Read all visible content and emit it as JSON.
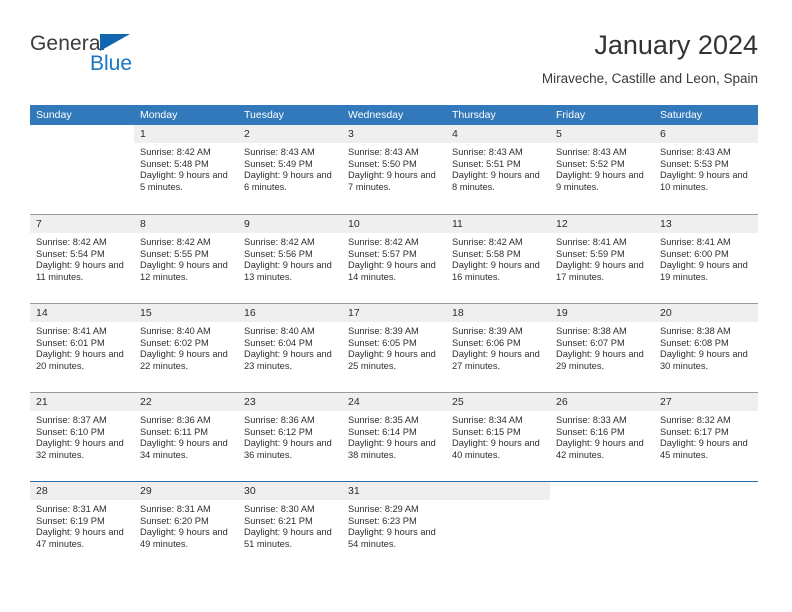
{
  "brand": {
    "name_top": "General",
    "name_bottom": "Blue",
    "triangle_color": "#1266b0",
    "blue_color": "#1a76c4"
  },
  "header": {
    "title": "January 2024",
    "subtitle": "Miraveche, Castille and Leon, Spain"
  },
  "theme": {
    "header_row_bg": "#3279bb",
    "header_row_text": "#ffffff",
    "day_number_bg": "#efefef",
    "row_border": "#9a9a9a",
    "last_row_border": "#2a6ca8"
  },
  "weekdays": [
    "Sunday",
    "Monday",
    "Tuesday",
    "Wednesday",
    "Thursday",
    "Friday",
    "Saturday"
  ],
  "weeks": [
    [
      {
        "day": "",
        "sunrise": "",
        "sunset": "",
        "daylight": "",
        "empty": true,
        "shaded": false
      },
      {
        "day": "1",
        "sunrise": "Sunrise: 8:42 AM",
        "sunset": "Sunset: 5:48 PM",
        "daylight": "Daylight: 9 hours and 5 minutes.",
        "empty": false,
        "shaded": true
      },
      {
        "day": "2",
        "sunrise": "Sunrise: 8:43 AM",
        "sunset": "Sunset: 5:49 PM",
        "daylight": "Daylight: 9 hours and 6 minutes.",
        "empty": false,
        "shaded": true
      },
      {
        "day": "3",
        "sunrise": "Sunrise: 8:43 AM",
        "sunset": "Sunset: 5:50 PM",
        "daylight": "Daylight: 9 hours and 7 minutes.",
        "empty": false,
        "shaded": true
      },
      {
        "day": "4",
        "sunrise": "Sunrise: 8:43 AM",
        "sunset": "Sunset: 5:51 PM",
        "daylight": "Daylight: 9 hours and 8 minutes.",
        "empty": false,
        "shaded": true
      },
      {
        "day": "5",
        "sunrise": "Sunrise: 8:43 AM",
        "sunset": "Sunset: 5:52 PM",
        "daylight": "Daylight: 9 hours and 9 minutes.",
        "empty": false,
        "shaded": true
      },
      {
        "day": "6",
        "sunrise": "Sunrise: 8:43 AM",
        "sunset": "Sunset: 5:53 PM",
        "daylight": "Daylight: 9 hours and 10 minutes.",
        "empty": false,
        "shaded": true
      }
    ],
    [
      {
        "day": "7",
        "sunrise": "Sunrise: 8:42 AM",
        "sunset": "Sunset: 5:54 PM",
        "daylight": "Daylight: 9 hours and 11 minutes.",
        "empty": false,
        "shaded": true
      },
      {
        "day": "8",
        "sunrise": "Sunrise: 8:42 AM",
        "sunset": "Sunset: 5:55 PM",
        "daylight": "Daylight: 9 hours and 12 minutes.",
        "empty": false,
        "shaded": true
      },
      {
        "day": "9",
        "sunrise": "Sunrise: 8:42 AM",
        "sunset": "Sunset: 5:56 PM",
        "daylight": "Daylight: 9 hours and 13 minutes.",
        "empty": false,
        "shaded": true
      },
      {
        "day": "10",
        "sunrise": "Sunrise: 8:42 AM",
        "sunset": "Sunset: 5:57 PM",
        "daylight": "Daylight: 9 hours and 14 minutes.",
        "empty": false,
        "shaded": true
      },
      {
        "day": "11",
        "sunrise": "Sunrise: 8:42 AM",
        "sunset": "Sunset: 5:58 PM",
        "daylight": "Daylight: 9 hours and 16 minutes.",
        "empty": false,
        "shaded": true
      },
      {
        "day": "12",
        "sunrise": "Sunrise: 8:41 AM",
        "sunset": "Sunset: 5:59 PM",
        "daylight": "Daylight: 9 hours and 17 minutes.",
        "empty": false,
        "shaded": true
      },
      {
        "day": "13",
        "sunrise": "Sunrise: 8:41 AM",
        "sunset": "Sunset: 6:00 PM",
        "daylight": "Daylight: 9 hours and 19 minutes.",
        "empty": false,
        "shaded": true
      }
    ],
    [
      {
        "day": "14",
        "sunrise": "Sunrise: 8:41 AM",
        "sunset": "Sunset: 6:01 PM",
        "daylight": "Daylight: 9 hours and 20 minutes.",
        "empty": false,
        "shaded": true
      },
      {
        "day": "15",
        "sunrise": "Sunrise: 8:40 AM",
        "sunset": "Sunset: 6:02 PM",
        "daylight": "Daylight: 9 hours and 22 minutes.",
        "empty": false,
        "shaded": true
      },
      {
        "day": "16",
        "sunrise": "Sunrise: 8:40 AM",
        "sunset": "Sunset: 6:04 PM",
        "daylight": "Daylight: 9 hours and 23 minutes.",
        "empty": false,
        "shaded": true
      },
      {
        "day": "17",
        "sunrise": "Sunrise: 8:39 AM",
        "sunset": "Sunset: 6:05 PM",
        "daylight": "Daylight: 9 hours and 25 minutes.",
        "empty": false,
        "shaded": true
      },
      {
        "day": "18",
        "sunrise": "Sunrise: 8:39 AM",
        "sunset": "Sunset: 6:06 PM",
        "daylight": "Daylight: 9 hours and 27 minutes.",
        "empty": false,
        "shaded": true
      },
      {
        "day": "19",
        "sunrise": "Sunrise: 8:38 AM",
        "sunset": "Sunset: 6:07 PM",
        "daylight": "Daylight: 9 hours and 29 minutes.",
        "empty": false,
        "shaded": true
      },
      {
        "day": "20",
        "sunrise": "Sunrise: 8:38 AM",
        "sunset": "Sunset: 6:08 PM",
        "daylight": "Daylight: 9 hours and 30 minutes.",
        "empty": false,
        "shaded": true
      }
    ],
    [
      {
        "day": "21",
        "sunrise": "Sunrise: 8:37 AM",
        "sunset": "Sunset: 6:10 PM",
        "daylight": "Daylight: 9 hours and 32 minutes.",
        "empty": false,
        "shaded": true
      },
      {
        "day": "22",
        "sunrise": "Sunrise: 8:36 AM",
        "sunset": "Sunset: 6:11 PM",
        "daylight": "Daylight: 9 hours and 34 minutes.",
        "empty": false,
        "shaded": true
      },
      {
        "day": "23",
        "sunrise": "Sunrise: 8:36 AM",
        "sunset": "Sunset: 6:12 PM",
        "daylight": "Daylight: 9 hours and 36 minutes.",
        "empty": false,
        "shaded": true
      },
      {
        "day": "24",
        "sunrise": "Sunrise: 8:35 AM",
        "sunset": "Sunset: 6:14 PM",
        "daylight": "Daylight: 9 hours and 38 minutes.",
        "empty": false,
        "shaded": true
      },
      {
        "day": "25",
        "sunrise": "Sunrise: 8:34 AM",
        "sunset": "Sunset: 6:15 PM",
        "daylight": "Daylight: 9 hours and 40 minutes.",
        "empty": false,
        "shaded": true
      },
      {
        "day": "26",
        "sunrise": "Sunrise: 8:33 AM",
        "sunset": "Sunset: 6:16 PM",
        "daylight": "Daylight: 9 hours and 42 minutes.",
        "empty": false,
        "shaded": true
      },
      {
        "day": "27",
        "sunrise": "Sunrise: 8:32 AM",
        "sunset": "Sunset: 6:17 PM",
        "daylight": "Daylight: 9 hours and 45 minutes.",
        "empty": false,
        "shaded": true
      }
    ],
    [
      {
        "day": "28",
        "sunrise": "Sunrise: 8:31 AM",
        "sunset": "Sunset: 6:19 PM",
        "daylight": "Daylight: 9 hours and 47 minutes.",
        "empty": false,
        "shaded": true
      },
      {
        "day": "29",
        "sunrise": "Sunrise: 8:31 AM",
        "sunset": "Sunset: 6:20 PM",
        "daylight": "Daylight: 9 hours and 49 minutes.",
        "empty": false,
        "shaded": true
      },
      {
        "day": "30",
        "sunrise": "Sunrise: 8:30 AM",
        "sunset": "Sunset: 6:21 PM",
        "daylight": "Daylight: 9 hours and 51 minutes.",
        "empty": false,
        "shaded": true
      },
      {
        "day": "31",
        "sunrise": "Sunrise: 8:29 AM",
        "sunset": "Sunset: 6:23 PM",
        "daylight": "Daylight: 9 hours and 54 minutes.",
        "empty": false,
        "shaded": true
      },
      {
        "day": "",
        "sunrise": "",
        "sunset": "",
        "daylight": "",
        "empty": true,
        "shaded": true
      },
      {
        "day": "",
        "sunrise": "",
        "sunset": "",
        "daylight": "",
        "empty": true,
        "shaded": false
      },
      {
        "day": "",
        "sunrise": "",
        "sunset": "",
        "daylight": "",
        "empty": true,
        "shaded": false
      }
    ]
  ]
}
